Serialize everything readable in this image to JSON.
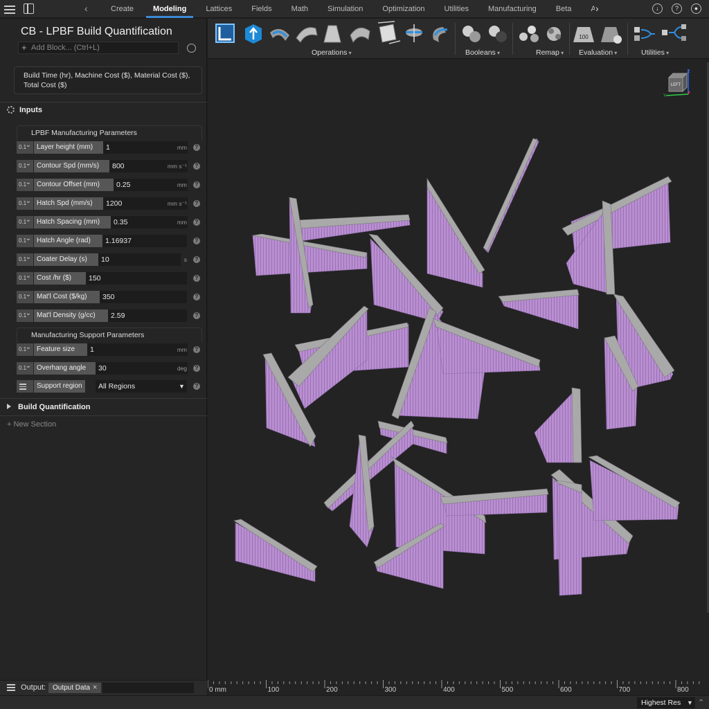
{
  "top_bar": {
    "tabs": [
      "Create",
      "Modeling",
      "Lattices",
      "Fields",
      "Math",
      "Simulation",
      "Optimization",
      "Utilities",
      "Manufacturing",
      "Beta",
      "Additi"
    ],
    "active_tab": "Modeling",
    "prev_arrow": "‹",
    "next_arrow": "›",
    "icons": [
      "download-icon",
      "help-icon",
      "account-icon"
    ],
    "help_glyph": "?"
  },
  "block": {
    "title": "CB - LPBF Build Quantification",
    "add_block_placeholder": "Add Block... (Ctrl+L)",
    "outputs_text": "Build Time (hr), Machine Cost ($), Material Cost ($), Total  Cost ($)"
  },
  "inputs": {
    "header": "Inputs",
    "group1": "LPBF Manufacturing Parameters",
    "group2": "Manufacturing Support Parameters",
    "type_tag": "0.1",
    "help_glyph": "?",
    "params": [
      {
        "label": "Layer height (mm)",
        "value": "1",
        "unit": "mm"
      },
      {
        "label": "Contour Spd (mm/s)",
        "value": "800",
        "unit": "mm s⁻¹"
      },
      {
        "label": "Contour Offset  (mm)",
        "value": "0.25",
        "unit": "mm"
      },
      {
        "label": "Hatch Spd (mm/s)",
        "value": "1200",
        "unit": "mm s⁻¹"
      },
      {
        "label": "Hatch Spacing (mm)",
        "value": "0.35",
        "unit": "mm"
      },
      {
        "label": "Hatch Angle (rad)",
        "value": "1.16937",
        "unit": ""
      },
      {
        "label": "Coater Delay (s)",
        "value": "10",
        "unit": "s"
      },
      {
        "label": "Cost /hr ($)",
        "value": "150",
        "unit": ""
      },
      {
        "label": "Mat'l Cost ($/kg)",
        "value": "350",
        "unit": ""
      },
      {
        "label": "Mat'l Density (g/cc)",
        "value": "2.59",
        "unit": ""
      }
    ],
    "support_params": [
      {
        "label": "Feature size",
        "value": "1",
        "unit": "mm"
      },
      {
        "label": "Overhang angle",
        "value": "30",
        "unit": "deg"
      }
    ],
    "support_region": {
      "label": "Support region",
      "value": "All Regions"
    }
  },
  "sections": {
    "build_quantification": "Build Quantification",
    "new_section": "New Section"
  },
  "toolbar": {
    "groups": [
      "Operations",
      "Booleans",
      "Remap",
      "Evaluation",
      "Utilities"
    ],
    "evaluation_icon_text": "100"
  },
  "viewport": {
    "viewcube_face": "LEFT",
    "axis_z": "Z",
    "axis_y": "Y",
    "ruler_labels": [
      "0 mm",
      "100",
      "200",
      "300",
      "400",
      "500",
      "600",
      "700",
      "800"
    ],
    "part_color": "#b98fd0",
    "support_color": "#a9a9a9"
  },
  "output_bar": {
    "label": "Output:",
    "chip": "Output Data",
    "close_glyph": "×"
  },
  "status_bar": {
    "resolution": "Highest Res"
  }
}
